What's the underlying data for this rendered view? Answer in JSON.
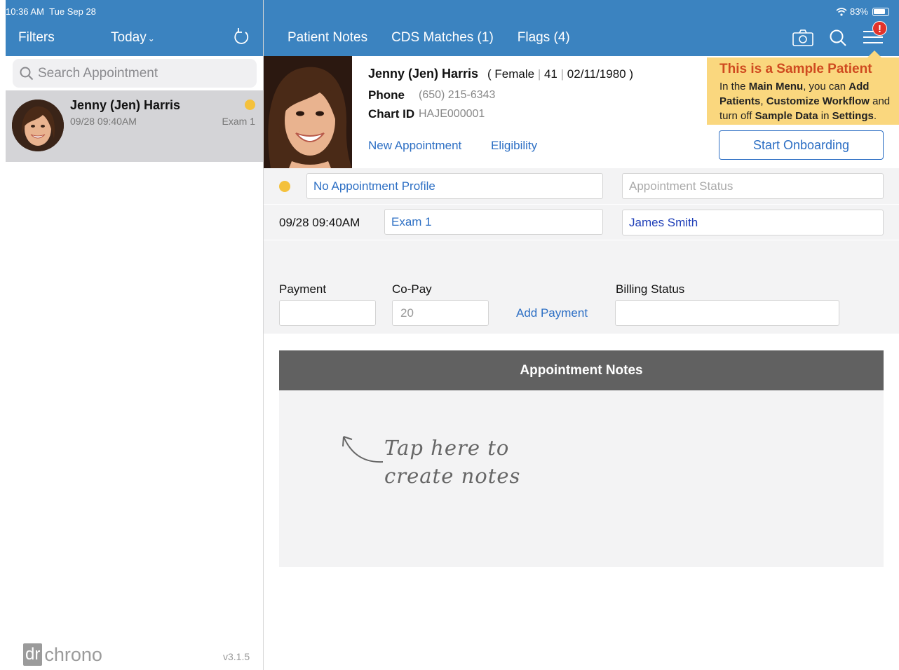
{
  "status_bar": {
    "time": "10:36 AM",
    "date": "Tue Sep 28",
    "battery": "83%"
  },
  "left_header": {
    "filters_label": "Filters",
    "today_label": "Today",
    "today_caret": "⌄"
  },
  "search": {
    "placeholder": "Search Appointment"
  },
  "appointments": [
    {
      "name": "Jenny (Jen) Harris",
      "time": "09/28 09:40AM",
      "room": "Exam 1",
      "status_color": "#f4c13c"
    }
  ],
  "footer": {
    "logo_box": "dr",
    "logo_text": "chrono",
    "version": "v3.1.5"
  },
  "tabs": [
    {
      "label": "Patient Notes"
    },
    {
      "label": "CDS Matches (1)"
    },
    {
      "label": "Flags (4)"
    }
  ],
  "menu_badge": "!",
  "patient": {
    "name": "Jenny (Jen) Harris",
    "gender": "Female",
    "age": "41",
    "dob": "02/11/1980",
    "phone_label": "Phone",
    "phone": "(650) 215-6343",
    "chart_label": "Chart ID",
    "chart_id": "HAJE000001",
    "new_appt_link": "New Appointment",
    "eligibility_link": "Eligibility"
  },
  "sample_notice": {
    "title": "This is a Sample Patient",
    "t1": "In the ",
    "b1": "Main Menu",
    "t2": ", you can ",
    "b2": "Add Patients",
    "t3": ", ",
    "b3": "Customize Workflow",
    "t4": " and turn off ",
    "b4": "Sample Data",
    "t5": " in ",
    "b5": "Settings",
    "t6": ".",
    "button": "Start Onboarding"
  },
  "appointment": {
    "profile": "No Appointment Profile",
    "status_placeholder": "Appointment Status",
    "time": "09/28 09:40AM",
    "room": "Exam 1",
    "provider": "James Smith"
  },
  "billing": {
    "payment_label": "Payment",
    "payment_value": "",
    "copay_label": "Co-Pay",
    "copay_placeholder": "20",
    "add_payment": "Add Payment",
    "billing_status_label": "Billing Status",
    "billing_status_value": ""
  },
  "notes": {
    "header": "Appointment Notes",
    "hint_line1": "Tap here to",
    "hint_line2": "create notes"
  },
  "colors": {
    "header_blue": "#3b83c0",
    "link_blue": "#2d6fc4",
    "status_yellow": "#f4c13c",
    "alert_red": "#e2332b",
    "notice_bg": "#fad77e",
    "notice_title": "#cf4a1f"
  }
}
